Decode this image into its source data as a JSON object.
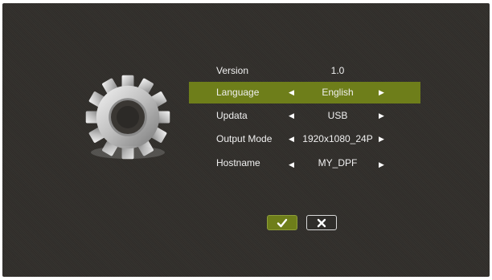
{
  "settings": {
    "rows": [
      {
        "label": "Version",
        "value": "1.0",
        "arrows": false
      },
      {
        "label": "Language",
        "value": "English",
        "arrows": true,
        "selected": true
      },
      {
        "label": "Updata",
        "value": "USB",
        "arrows": true
      },
      {
        "label": "Output Mode",
        "value": "1920x1080_24P",
        "arrows": true
      },
      {
        "label": "Hostname",
        "value": "MY_DPF",
        "arrows": true
      }
    ],
    "arrow_left": "◀",
    "arrow_right": "▶"
  },
  "buttons": {
    "ok_icon": "check-icon",
    "cancel_icon": "close-icon"
  },
  "colors": {
    "highlight": "#6e7e1a",
    "background": "#33302c",
    "text": "#f0f0f0"
  }
}
